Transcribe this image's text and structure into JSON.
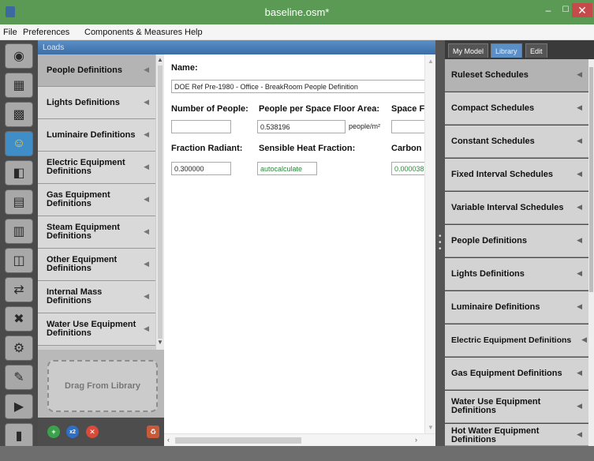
{
  "window": {
    "title": "baseline.osm*",
    "minimize": "–",
    "maximize": "☐",
    "close": "✕"
  },
  "menu": [
    "File",
    "Preferences",
    "Components & Measures",
    "Help"
  ],
  "left_icons": [
    {
      "name": "site-icon",
      "glyph": "◉"
    },
    {
      "name": "schedules-icon",
      "glyph": "▦"
    },
    {
      "name": "constructions-icon",
      "glyph": "▩"
    },
    {
      "name": "loads-icon",
      "glyph": "☺"
    },
    {
      "name": "space-types-icon",
      "glyph": "◧"
    },
    {
      "name": "geometry-icon",
      "glyph": "▤"
    },
    {
      "name": "facility-icon",
      "glyph": "▥"
    },
    {
      "name": "spaces-icon",
      "glyph": "◫"
    },
    {
      "name": "thermal-zones-icon",
      "glyph": "⇄"
    },
    {
      "name": "hvac-icon",
      "glyph": "✖"
    },
    {
      "name": "output-variables-icon",
      "glyph": "⚙"
    },
    {
      "name": "simulation-settings-icon",
      "glyph": "✎"
    },
    {
      "name": "run-simulation-icon",
      "glyph": "▶"
    },
    {
      "name": "results-icon",
      "glyph": "▮"
    }
  ],
  "loads_header": "Loads",
  "subtabs": [
    "People Definitions",
    "Lights Definitions",
    "Luminaire Definitions",
    "Electric Equipment Definitions",
    "Gas Equipment Definitions",
    "Steam Equipment Definitions",
    "Other Equipment Definitions",
    "Internal Mass Definitions",
    "Water Use Equipment Definitions"
  ],
  "drag_from_library": "Drag From Library",
  "bottom_buttons": {
    "add": "+",
    "copy": "x2",
    "delete": "✕",
    "purge": "♻"
  },
  "editor": {
    "name_label": "Name:",
    "name_value": "DOE Ref Pre-1980 - Office - BreakRoom People Definition",
    "number_of_people_label": "Number of People:",
    "number_of_people_value": "",
    "people_per_area_label": "People per Space Floor Area:",
    "people_per_area_value": "0.538196",
    "people_per_area_unit": "people/m²",
    "space_floor_label": "Space Fl",
    "space_floor_value": "",
    "fraction_radiant_label": "Fraction Radiant:",
    "fraction_radiant_value": "0.300000",
    "sensible_heat_label": "Sensible Heat Fraction:",
    "sensible_heat_value": "autocalculate",
    "carbon_label": "Carbon I",
    "carbon_value": "0.000038"
  },
  "right_tabs": [
    "My Model",
    "Library",
    "Edit"
  ],
  "library_items": [
    "Ruleset Schedules",
    "Compact Schedules",
    "Constant Schedules",
    "Fixed Interval Schedules",
    "Variable Interval Schedules",
    "People Definitions",
    "Lights Definitions",
    "Luminaire Definitions",
    "Electric Equipment Definitions",
    "Gas Equipment Definitions",
    "Water Use Equipment Definitions",
    "Hot Water Equipment Definitions"
  ]
}
